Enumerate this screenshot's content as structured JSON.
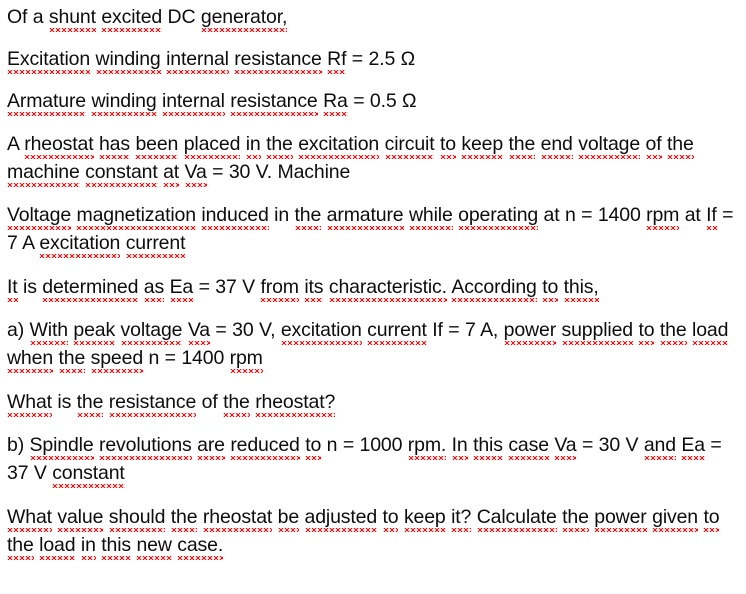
{
  "document": {
    "background_color": "#ffffff",
    "text_color": "#0d0d0d",
    "spellcheck_underline_color": "#ee1111",
    "paragraphs": [
      {
        "id": "intro",
        "lines": [
          "Of a shunt excited DC generator,"
        ]
      },
      {
        "id": "field-resistance",
        "lines": [
          "Excitation winding internal resistance Rf = 2.5 Ω"
        ]
      },
      {
        "id": "armature-resistance",
        "lines": [
          "Armature winding internal resistance Ra = 0.5 Ω"
        ]
      },
      {
        "id": "rheostat-placement",
        "lines": [
          "A rheostat has been placed in the excitation circuit to keep the end voltage of",
          "the machine constant at Va = 30 V. Machine"
        ]
      },
      {
        "id": "magnetization",
        "lines": [
          "Voltage magnetization induced in the armature while operating at n = 1400",
          "rpm at If = 7 A excitation current"
        ]
      },
      {
        "id": "characteristic",
        "lines": [
          "It is determined as Ea = 37 V from its characteristic. According to this,"
        ]
      },
      {
        "id": "question-a",
        "lines": [
          "a) With peak voltage Va = 30 V, excitation current If = 7 A, power supplied to",
          "the load when the speed n = 1400 rpm"
        ]
      },
      {
        "id": "question-a-ask",
        "lines": [
          "What is the resistance of the rheostat?"
        ]
      },
      {
        "id": "question-b",
        "lines": [
          "b) Spindle revolutions are reduced to n = 1000 rpm. In this case Va = 30 V and",
          "Ea = 37 V constant"
        ]
      },
      {
        "id": "question-b-ask",
        "lines": [
          "What value should the rheostat be adjusted to keep it? Calculate the power",
          "given to the load in this new case."
        ]
      }
    ],
    "misspelled_words": [
      "shunt",
      "excited",
      "generator",
      "Excitation",
      "winding",
      "internal",
      "resistance",
      "Rf",
      "Armature",
      "Ra",
      "rheostat",
      "has",
      "been",
      "placed",
      "the",
      "excitation",
      "circuit",
      "to",
      "keep",
      "end",
      "voltage",
      "of",
      "machine",
      "constant",
      "at",
      "Va",
      "Voltage",
      "magnetization",
      "induced",
      "in",
      "armature",
      "while",
      "operating",
      "rpm",
      "If",
      "current",
      "It",
      "determined",
      "as",
      "Ea",
      "from",
      "its",
      "characteristic",
      "According",
      "this",
      "With",
      "peak",
      "power",
      "supplied",
      "load",
      "when",
      "speed",
      "What",
      "is",
      "Spindle",
      "revolutions",
      "are",
      "reduced",
      "case",
      "and",
      "value",
      "should",
      "be",
      "adjusted",
      "Calculate",
      "given",
      "new"
    ]
  }
}
